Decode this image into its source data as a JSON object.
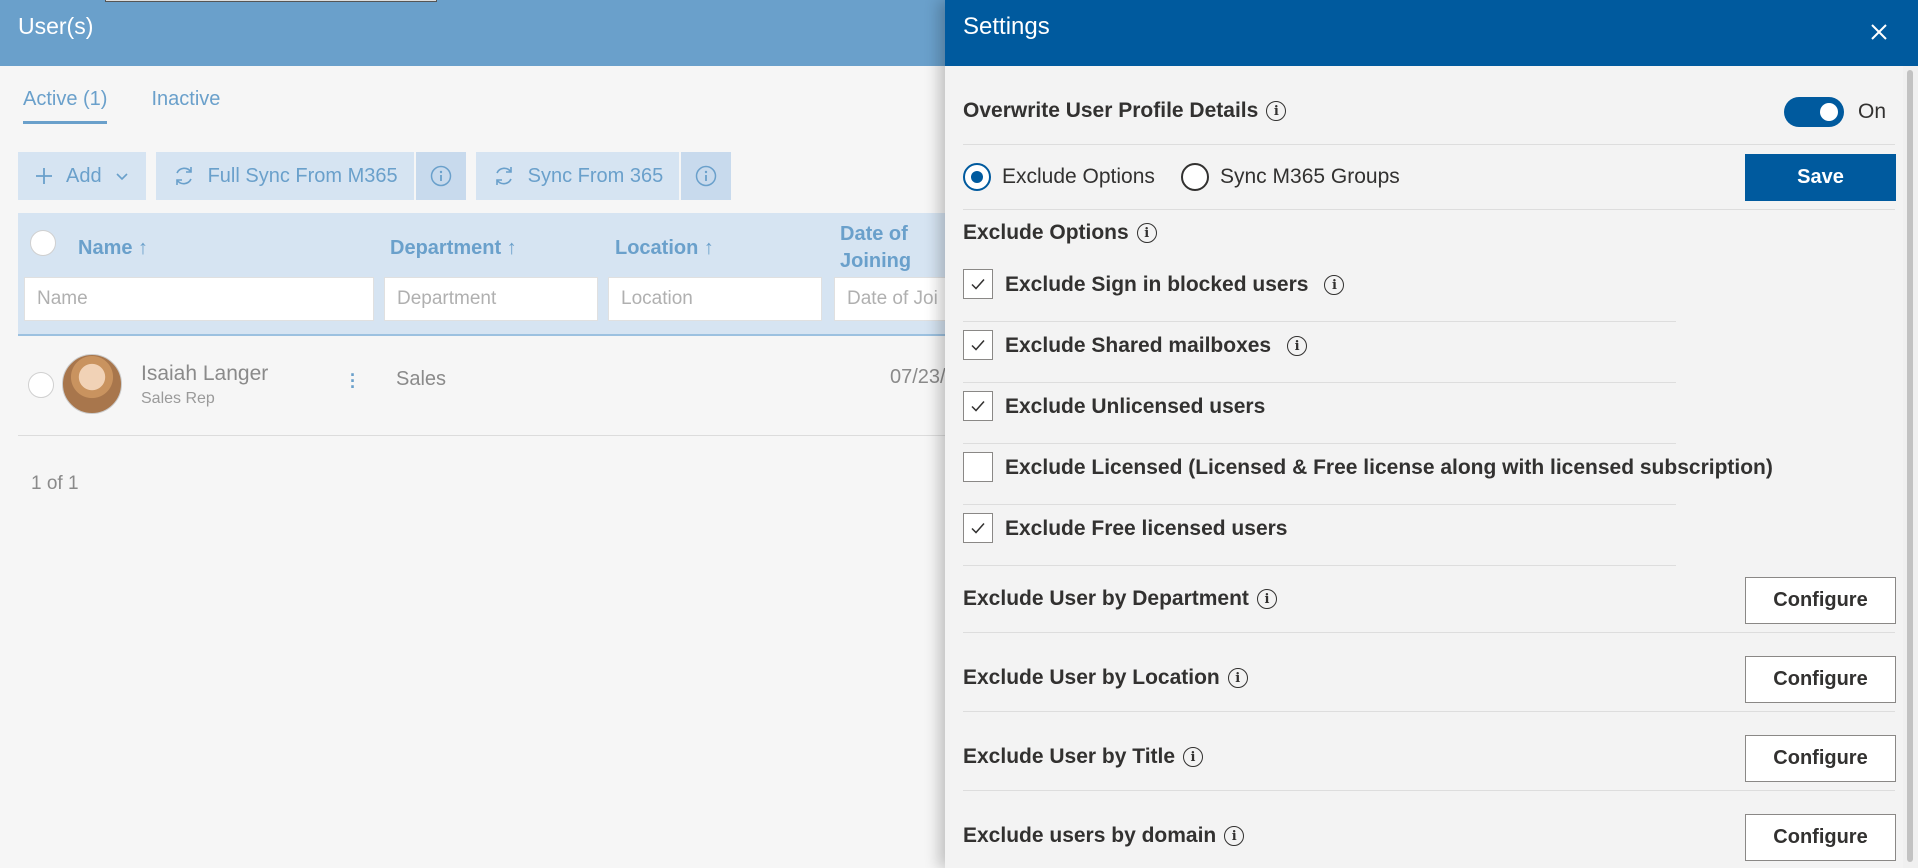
{
  "app": {
    "title": "User(s)"
  },
  "tabs": [
    {
      "label": "Active (1)",
      "active": true
    },
    {
      "label": "Inactive",
      "active": false
    }
  ],
  "toolbar": {
    "add_label": "Add",
    "full_sync_label": "Full Sync From M365",
    "sync_label": "Sync From 365"
  },
  "table": {
    "columns": [
      "Name",
      "Department",
      "Location",
      "Date of Joining"
    ],
    "column_sort_glyph": "↑",
    "filters": [
      "Name",
      "Department",
      "Location",
      "Date of Joi"
    ],
    "rows": [
      {
        "name": "Isaiah Langer",
        "title": "Sales Rep",
        "department": "Sales",
        "date": "07/23/"
      }
    ],
    "pager": "1 of 1"
  },
  "settings": {
    "title": "Settings",
    "overwrite_label": "Overwrite User Profile Details",
    "toggle_state": "On",
    "radio_options": [
      {
        "label": "Exclude Options",
        "selected": true
      },
      {
        "label": "Sync M365 Groups",
        "selected": false
      }
    ],
    "save_label": "Save",
    "exclude_heading": "Exclude Options",
    "checkboxes": [
      {
        "label": "Exclude Sign in blocked users",
        "checked": true,
        "info": true
      },
      {
        "label": "Exclude Shared mailboxes",
        "checked": true,
        "info": true
      },
      {
        "label": "Exclude Unlicensed users",
        "checked": true,
        "info": false
      },
      {
        "label": "Exclude Licensed (Licensed & Free license along with licensed subscription)",
        "checked": false,
        "info": false
      },
      {
        "label": "Exclude Free licensed users",
        "checked": true,
        "info": false
      }
    ],
    "configure_rows": [
      {
        "label": "Exclude User by Department",
        "button": "Configure"
      },
      {
        "label": "Exclude User by Location",
        "button": "Configure"
      },
      {
        "label": "Exclude User by Title",
        "button": "Configure"
      },
      {
        "label": "Exclude users by domain",
        "button": "Configure"
      }
    ]
  },
  "colors": {
    "panel_header": "#005a9e",
    "dimmed_header": "#6aa0cb",
    "accent_light": "#d6e4f2"
  }
}
